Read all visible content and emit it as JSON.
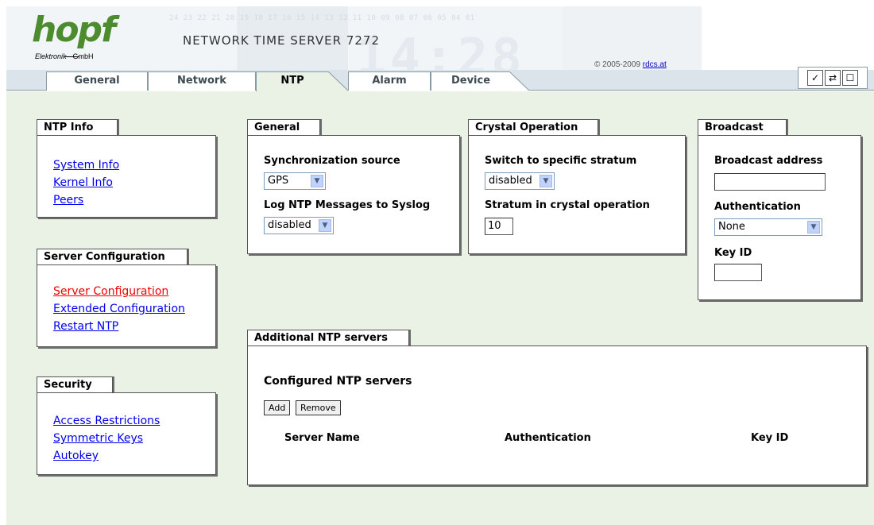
{
  "header": {
    "logo_word": "hopf",
    "logo_sub_left": "Elektronik",
    "logo_sub_right": "GmbH",
    "bg_digits": "24 23 22 21 20 19 18 17 16 15 14 13 12 11 10 09 08 07 06 05 04 01",
    "bg_clock": "14:28",
    "product_title": "NETWORK TIME SERVER 7272",
    "copyright_prefix": "© 2005-2009",
    "copyright_link": "rdcs.at"
  },
  "tabs": [
    {
      "label": "General",
      "active": false
    },
    {
      "label": "Network",
      "active": false
    },
    {
      "label": "NTP",
      "active": true
    },
    {
      "label": "Alarm",
      "active": false
    },
    {
      "label": "Device",
      "active": false
    }
  ],
  "toolbar": {
    "icons": [
      "check-icon",
      "refresh-icon",
      "page-icon"
    ],
    "glyphs": [
      "✓",
      "⇄",
      "☐"
    ]
  },
  "ntp_info": {
    "title": "NTP Info",
    "links": [
      "System Info",
      "Kernel Info",
      "Peers"
    ]
  },
  "server_config": {
    "title": "Server Configuration",
    "links": [
      "Server Configuration",
      "Extended Configuration",
      "Restart NTP"
    ],
    "active_link": "Server Configuration"
  },
  "security": {
    "title": "Security",
    "links": [
      "Access Restrictions",
      "Symmetric Keys",
      "Autokey"
    ]
  },
  "general": {
    "title": "General",
    "sync_label": "Synchronization source",
    "sync_value": "GPS",
    "log_label": "Log NTP Messages to Syslog",
    "log_value": "disabled"
  },
  "crystal": {
    "title": "Crystal Operation",
    "switch_label": "Switch to specific stratum",
    "switch_value": "disabled",
    "stratum_label": "Stratum in crystal operation",
    "stratum_value": "10"
  },
  "broadcast": {
    "title": "Broadcast",
    "address_label": "Broadcast address",
    "address_value": "",
    "auth_label": "Authentication",
    "auth_value": "None",
    "keyid_label": "Key ID",
    "keyid_value": ""
  },
  "additional": {
    "title": "Additional NTP servers",
    "subtitle": "Configured NTP servers",
    "add_label": "Add",
    "remove_label": "Remove",
    "columns": [
      "Server Name",
      "Authentication",
      "Key ID"
    ]
  },
  "colors": {
    "content_bg": "#eaf2e5",
    "tabbar_bg": "#dbe4ea",
    "link": "#0000ee",
    "active_link": "#ee0000",
    "logo_green": "#4d8b2f"
  }
}
